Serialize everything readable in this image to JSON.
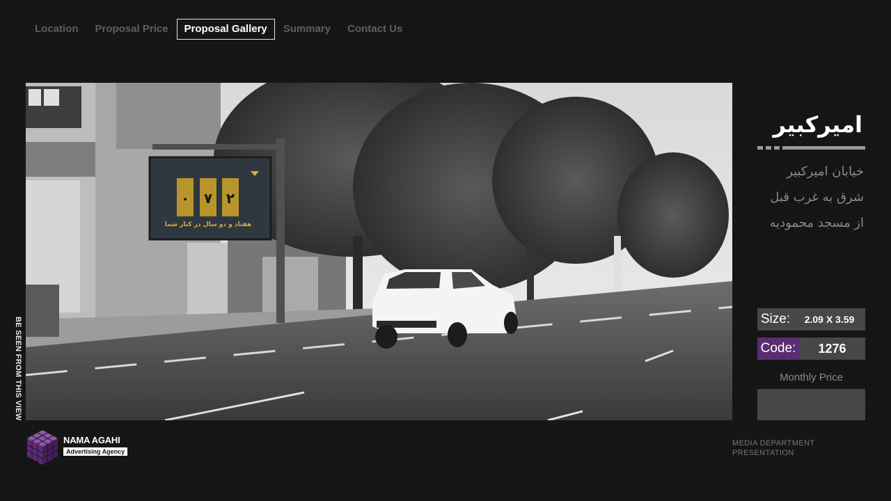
{
  "nav": {
    "items": [
      "Location",
      "Proposal Price",
      "Proposal Gallery",
      "Summary",
      "Contact Us"
    ],
    "active": "Proposal Gallery"
  },
  "photo": {
    "vertical_caption": "BE SEEN FROM THIS VIEW",
    "billboard": {
      "digits": [
        "۰",
        "۷",
        "۲"
      ],
      "caption": "هفتاد و دو سال در کنار شما"
    }
  },
  "location": {
    "title": "امیرکبیر",
    "address_lines": [
      "خیابان  امیرکبیر",
      "شرق به  غرب قبل",
      "از مسجد محمودیه"
    ]
  },
  "specs": {
    "size_label": "Size:",
    "size_value": "2.09 X 3.59",
    "code_label": "Code:",
    "code_value": "1276",
    "monthly_price_label": "Monthly Price",
    "monthly_price_value": ""
  },
  "footer": {
    "logo_name": "NAMA AGAHI",
    "logo_tagline": "Advertising Agency",
    "department_line1": "MEDIA DEPARTMENT",
    "department_line2": "PRESENTATION"
  },
  "colors": {
    "accent_purple": "#5b2d70",
    "panel_gray": "#474747",
    "background": "#121212"
  }
}
